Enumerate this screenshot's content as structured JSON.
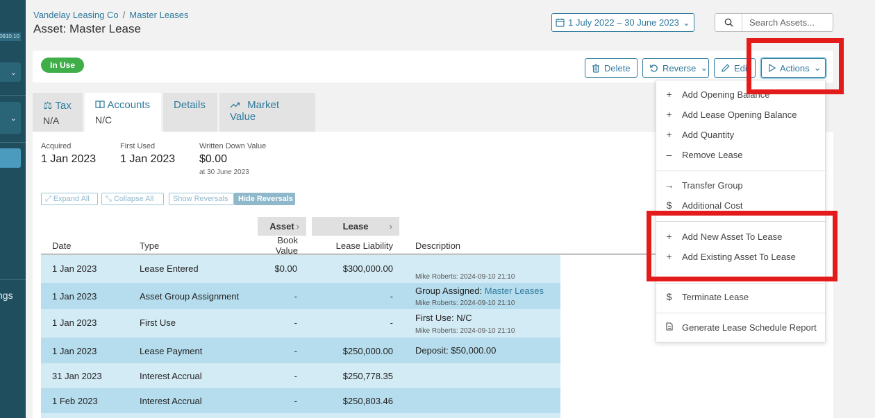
{
  "sidebar": {
    "version": "0910.10",
    "settings_label": "ngs"
  },
  "header": {
    "breadcrumb": [
      "Vandelay Leasing Co",
      "Master Leases"
    ],
    "breadcrumb_sep": "/",
    "title": "Asset: Master Lease",
    "date_range": "1 July 2022 – 30 June 2023",
    "search_placeholder": "Search Assets..."
  },
  "toolbar": {
    "status": "In Use",
    "delete": "Delete",
    "reverse": "Reverse",
    "edit": "Edit",
    "actions": "Actions"
  },
  "tabs": [
    {
      "label": "Tax",
      "sub": "N/A",
      "icon": "scale-icon"
    },
    {
      "label": "Accounts",
      "sub": "N/C",
      "icon": "book-icon"
    },
    {
      "label": "Details",
      "sub": ""
    },
    {
      "label": "Market Value",
      "sub": "",
      "icon": "trend-icon"
    }
  ],
  "summary": {
    "acquired_label": "Acquired",
    "acquired": "1 Jan 2023",
    "first_used_label": "First Used",
    "first_used": "1 Jan 2023",
    "wdv_label": "Written Down Value",
    "wdv": "$0.00",
    "wdv_note": "at 30 June 2023"
  },
  "table_controls": {
    "expand_all": "Expand All",
    "collapse_all": "Collapse All",
    "show_reversals": "Show Reversals",
    "hide_reversals": "Hide Reversals"
  },
  "table": {
    "groups": [
      "Asset",
      "Lease"
    ],
    "columns": {
      "date": "Date",
      "type": "Type",
      "book_value": "Book Value",
      "lease_liability": "Lease Liability",
      "description": "Description"
    },
    "rows": [
      {
        "date": "1 Jan 2023",
        "type": "Lease Entered",
        "book": "$0.00",
        "liability": "$300,000.00",
        "desc": "",
        "desc_link": "",
        "meta": "Mike Roberts: 2024-09-10 21:10"
      },
      {
        "date": "1 Jan 2023",
        "type": "Asset Group Assignment",
        "book": "-",
        "liability": "-",
        "desc": "Group Assigned:",
        "desc_link": "Master Leases",
        "meta": "Mike Roberts: 2024-09-10 21:10"
      },
      {
        "date": "1 Jan 2023",
        "type": "First Use",
        "book": "-",
        "liability": "-",
        "desc": "First Use: N/C",
        "desc_link": "",
        "meta": "Mike Roberts: 2024-09-10 21:10"
      },
      {
        "date": "1 Jan 2023",
        "type": "Lease Payment",
        "book": "-",
        "liability": "$250,000.00",
        "desc": "Deposit: $50,000.00",
        "desc_link": "",
        "meta": ""
      },
      {
        "date": "31 Jan 2023",
        "type": "Interest Accrual",
        "book": "-",
        "liability": "$250,778.35",
        "desc": "",
        "desc_link": "",
        "meta": ""
      },
      {
        "date": "1 Feb 2023",
        "type": "Interest Accrual",
        "book": "-",
        "liability": "$250,803.46",
        "desc": "",
        "desc_link": "",
        "meta": ""
      }
    ]
  },
  "actions_menu": {
    "items": [
      {
        "icon": "plus-icon",
        "label": "Add Opening Balance"
      },
      {
        "icon": "plus-icon",
        "label": "Add Lease Opening Balance"
      },
      {
        "icon": "plus-icon",
        "label": "Add Quantity"
      },
      {
        "icon": "minus-icon",
        "label": "Remove Lease"
      },
      {
        "icon": "arrow-right-icon",
        "label": "Transfer Group"
      },
      {
        "icon": "dollar-icon",
        "label": "Additional Cost"
      },
      {
        "icon": "plus-icon",
        "label": "Add New Asset To Lease"
      },
      {
        "icon": "plus-icon",
        "label": "Add Existing Asset To Lease"
      },
      {
        "icon": "dollar-icon",
        "label": "Terminate Lease"
      },
      {
        "icon": "document-icon",
        "label": "Generate Lease Schedule Report"
      }
    ]
  },
  "colors": {
    "primary": "#2f7a9c",
    "sidebar": "#1f4e5f",
    "status_green": "#3fae49",
    "row_light": "#d3ebf5",
    "row_dark": "#b6dded",
    "highlight_red": "#e31b1b"
  }
}
